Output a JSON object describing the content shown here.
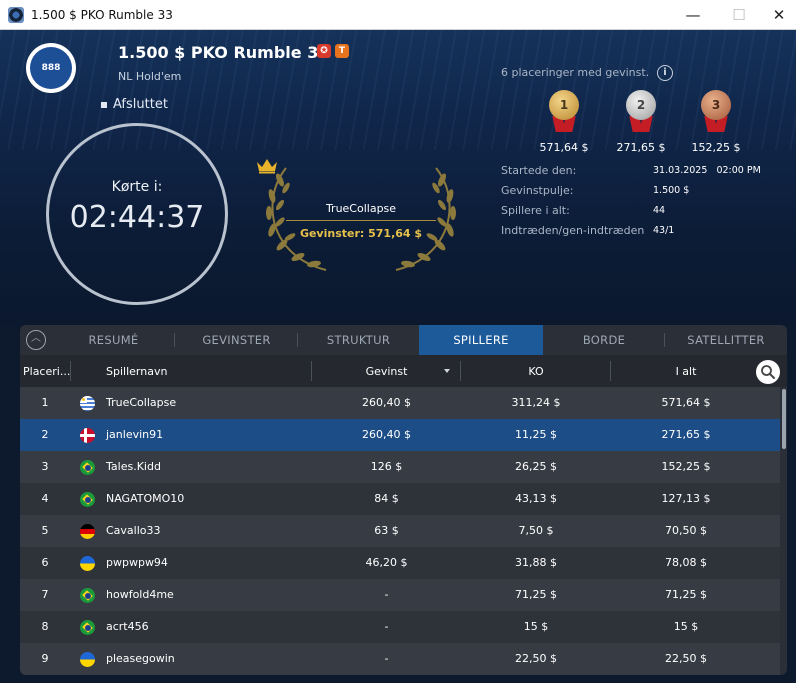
{
  "window": {
    "title": "1.500 $ PKO Rumble 33",
    "min": "—",
    "max": "☐",
    "close": "✕"
  },
  "tournament": {
    "logo_text": "888",
    "title": "1.500 $ PKO Rumble 33",
    "badge1": "✪",
    "badge2": "T",
    "game": "NL Hold'em",
    "status": "Afsluttet"
  },
  "clock": {
    "label": "Kørte i:",
    "time": "02:44:37"
  },
  "winner": {
    "name": "TrueCollapse",
    "winnings": "Gevinster: 571,64 $"
  },
  "prizes": {
    "places_text": "6 placeringer med gevinst.",
    "info_icon": "i",
    "medals": [
      {
        "rank": "1",
        "amount": "571,64 $"
      },
      {
        "rank": "2",
        "amount": "271,65 $"
      },
      {
        "rank": "3",
        "amount": "152,25 $"
      }
    ]
  },
  "stats": [
    {
      "label": "Startede den:",
      "value": "31.03.2025   02:00 PM"
    },
    {
      "label": "Gevinstpulje:",
      "value": "1.500 $"
    },
    {
      "label": "Spillere i alt:",
      "value": "44"
    },
    {
      "label": "Indtræden/gen-indtræden",
      "value": "43/1"
    }
  ],
  "tabs": [
    "RESUMÉ",
    "GEVINSTER",
    "STRUKTUR",
    "SPILLERE",
    "BORDE",
    "SATELLITTER"
  ],
  "active_tab": "SPILLERE",
  "collapse_icon": "︿",
  "columns": {
    "place": "Placeri...",
    "name": "Spillernavn",
    "win": "Gevinst",
    "ko": "KO",
    "total": "I alt"
  },
  "players": [
    {
      "rank": "1",
      "flag": "uy",
      "name": "TrueCollapse",
      "win": "260,40 $",
      "ko": "311,24 $",
      "total": "571,64 $"
    },
    {
      "rank": "2",
      "flag": "dk",
      "name": "janlevin91",
      "win": "260,40 $",
      "ko": "11,25 $",
      "total": "271,65 $"
    },
    {
      "rank": "3",
      "flag": "br",
      "name": "Tales.Kidd",
      "win": "126 $",
      "ko": "26,25 $",
      "total": "152,25 $"
    },
    {
      "rank": "4",
      "flag": "br",
      "name": "NAGATOMO10",
      "win": "84 $",
      "ko": "43,13 $",
      "total": "127,13 $"
    },
    {
      "rank": "5",
      "flag": "de",
      "name": "Cavallo33",
      "win": "63 $",
      "ko": "7,50 $",
      "total": "70,50 $"
    },
    {
      "rank": "6",
      "flag": "ua",
      "name": "pwpwpw94",
      "win": "46,20 $",
      "ko": "31,88 $",
      "total": "78,08 $"
    },
    {
      "rank": "7",
      "flag": "br",
      "name": "howfold4me",
      "win": "-",
      "ko": "71,25 $",
      "total": "71,25 $"
    },
    {
      "rank": "8",
      "flag": "br",
      "name": "acrt456",
      "win": "-",
      "ko": "15 $",
      "total": "15 $"
    },
    {
      "rank": "9",
      "flag": "ua",
      "name": "pleasegowin",
      "win": "-",
      "ko": "22,50 $",
      "total": "22,50 $"
    }
  ],
  "selected_row": "2",
  "colors": {
    "accent": "#1d5a9a",
    "selected_row": "#1d4d86",
    "gold": "#e6c04a"
  }
}
